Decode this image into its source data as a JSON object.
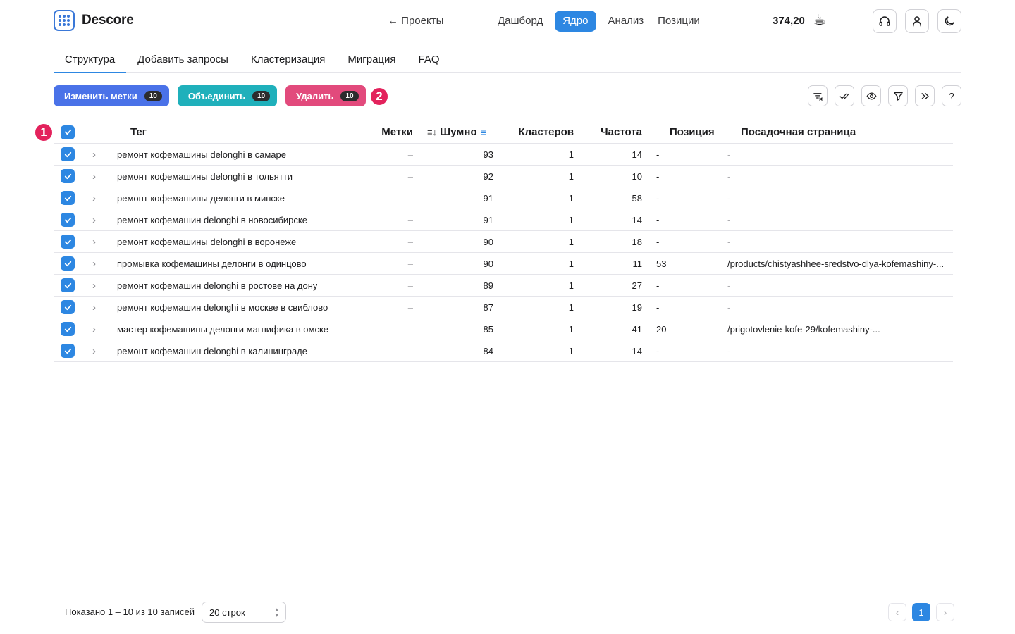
{
  "header": {
    "brand": "Descore",
    "back_label": "← Проекты",
    "nav": [
      "Дашборд",
      "Ядро",
      "Анализ",
      "Позиции"
    ],
    "nav_active": "Ядро",
    "balance": "374,20",
    "coffee_icon": "coffee-icon",
    "icons": [
      "headset-icon",
      "user-icon",
      "moon-icon"
    ]
  },
  "tabs": [
    "Структура",
    "Добавить запросы",
    "Кластеризация",
    "Миграция",
    "FAQ"
  ],
  "tab_active": "Структура",
  "actions": {
    "edit_tags": {
      "label": "Изменить метки",
      "count": "10"
    },
    "merge": {
      "label": "Объединить",
      "count": "10"
    },
    "delete": {
      "label": "Удалить",
      "count": "10"
    }
  },
  "markers": [
    "1",
    "2"
  ],
  "toolbar_icons": [
    "clear-filter-icon",
    "check-all-icon",
    "eye-icon",
    "filter-icon",
    "expand-icon",
    "help-icon"
  ],
  "toolbar_help": "?",
  "table": {
    "headers": {
      "tag": "Тег",
      "labels": "Метки",
      "noise": "Шумно",
      "clusters": "Кластеров",
      "frequency": "Частота",
      "position": "Позиция",
      "landing": "Посадочная страница"
    },
    "rows": [
      {
        "tag": "ремонт кофемашины delonghi в самаре",
        "labels": "–",
        "noise": "93",
        "clusters": "1",
        "frequency": "14",
        "position": "-",
        "landing": "-"
      },
      {
        "tag": "ремонт кофемашины delonghi в тольятти",
        "labels": "–",
        "noise": "92",
        "clusters": "1",
        "frequency": "10",
        "position": "-",
        "landing": "-"
      },
      {
        "tag": "ремонт кофемашины делонги в минске",
        "labels": "–",
        "noise": "91",
        "clusters": "1",
        "frequency": "58",
        "position": "-",
        "landing": "-"
      },
      {
        "tag": "ремонт кофемашин delonghi в новосибирске",
        "labels": "–",
        "noise": "91",
        "clusters": "1",
        "frequency": "14",
        "position": "-",
        "landing": "-"
      },
      {
        "tag": "ремонт кофемашины delonghi в воронеже",
        "labels": "–",
        "noise": "90",
        "clusters": "1",
        "frequency": "18",
        "position": "-",
        "landing": "-"
      },
      {
        "tag": "промывка кофемашины делонги в одинцово",
        "labels": "–",
        "noise": "90",
        "clusters": "1",
        "frequency": "11",
        "position": "53",
        "landing": "/products/chistyashhee-sredstvo-dlya-kofemashiny-..."
      },
      {
        "tag": "ремонт кофемашин delonghi в ростове на дону",
        "labels": "–",
        "noise": "89",
        "clusters": "1",
        "frequency": "27",
        "position": "-",
        "landing": "-"
      },
      {
        "tag": "ремонт кофемашин delonghi в москве в свиблово",
        "labels": "–",
        "noise": "87",
        "clusters": "1",
        "frequency": "19",
        "position": "-",
        "landing": "-"
      },
      {
        "tag": "мастер кофемашины делонги магнифика в омске",
        "labels": "–",
        "noise": "85",
        "clusters": "1",
        "frequency": "41",
        "position": "20",
        "landing": "/prigotovlenie-kofe-29/kofemashiny-..."
      },
      {
        "tag": "ремонт кофемашин delonghi в калининграде",
        "labels": "–",
        "noise": "84",
        "clusters": "1",
        "frequency": "14",
        "position": "-",
        "landing": "-"
      }
    ]
  },
  "footer": {
    "summary": "Показано 1 – 10 из 10 записей",
    "rows_per_page": "20 строк",
    "current_page": "1"
  },
  "colors": {
    "accent": "#2d87e2",
    "edit_btn": "#4a72e8",
    "merge_btn": "#1fb0bb",
    "delete_btn": "#e24a7c",
    "marker": "#e3225c"
  }
}
